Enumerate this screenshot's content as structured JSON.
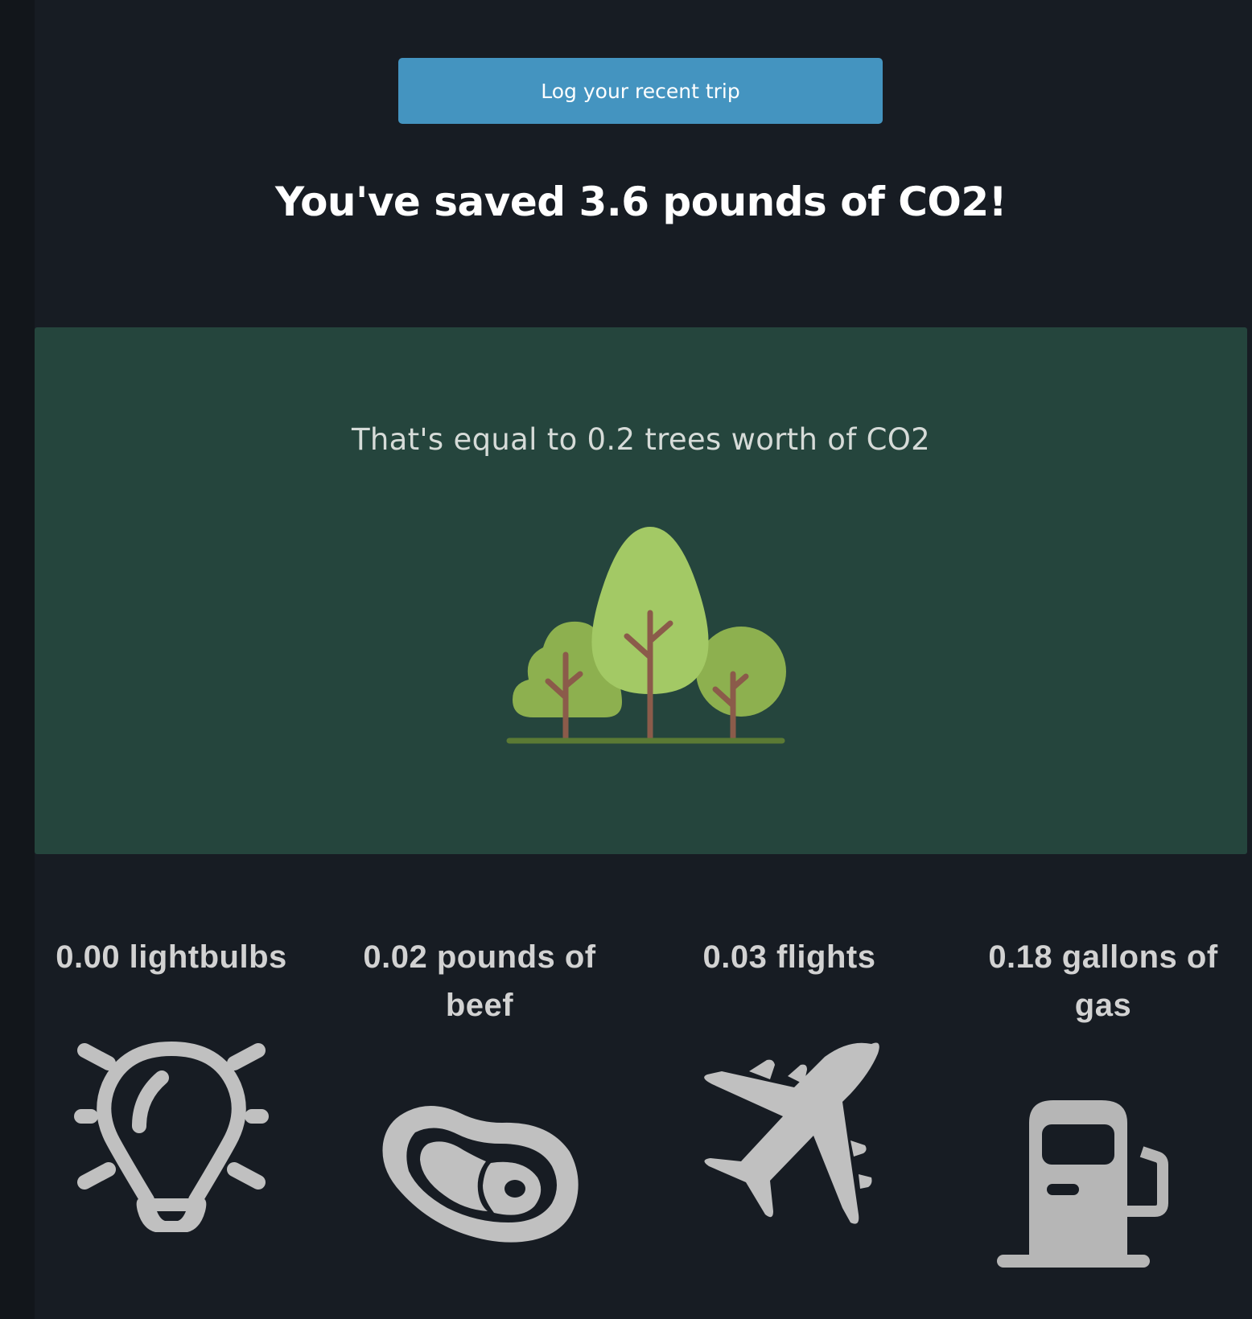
{
  "actions": {
    "log_trip_label": "Log your recent trip"
  },
  "summary": {
    "headline": "You've saved 3.6 pounds of CO2!"
  },
  "trees": {
    "text": "That's equal to 0.2 trees worth of CO2",
    "icon": "trees-icon"
  },
  "equivalents": [
    {
      "label": "0.00 lightbulbs",
      "icon": "lightbulb-icon"
    },
    {
      "label": "0.02 pounds of beef",
      "icon": "steak-icon"
    },
    {
      "label": "0.03 flights",
      "icon": "airplane-icon"
    },
    {
      "label": "0.18 gallons of gas",
      "icon": "gas-pump-icon"
    }
  ],
  "colors": {
    "background": "#171c23",
    "button": "#4494c0",
    "card": "#25453d",
    "icon_gray": "#c0c0c0"
  }
}
